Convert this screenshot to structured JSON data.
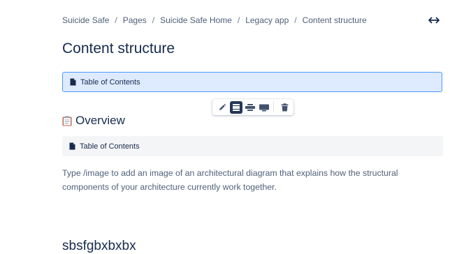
{
  "breadcrumb": {
    "items": [
      "Suicide Safe",
      "Pages",
      "Suicide Safe Home",
      "Legacy app",
      "Content structure"
    ],
    "separator": "/"
  },
  "page": {
    "title": "Content structure"
  },
  "macros": {
    "toc_selected_label": "Table of Contents",
    "toc_label": "Table of Contents"
  },
  "floating_toolbar": {
    "buttons": [
      "edit-icon",
      "layout-center-icon",
      "layout-wide-icon",
      "layout-full-width-icon",
      "delete-icon"
    ],
    "active": "layout-center-icon"
  },
  "section": {
    "overview_emoji": "clipboard-icon",
    "overview_title": "Overview",
    "paragraph": "Type /image to add an image of an architectural diagram that explains how the structural components of your architecture currently work together.",
    "next_heading": "sbsfgbxbxbx"
  },
  "colors": {
    "text_primary": "#172b4d",
    "text_secondary": "#505f79",
    "selection_bg": "#deebff",
    "selection_border": "#4c9aff",
    "macro_bg": "#f4f5f7",
    "toolbar_active": "#253858"
  }
}
